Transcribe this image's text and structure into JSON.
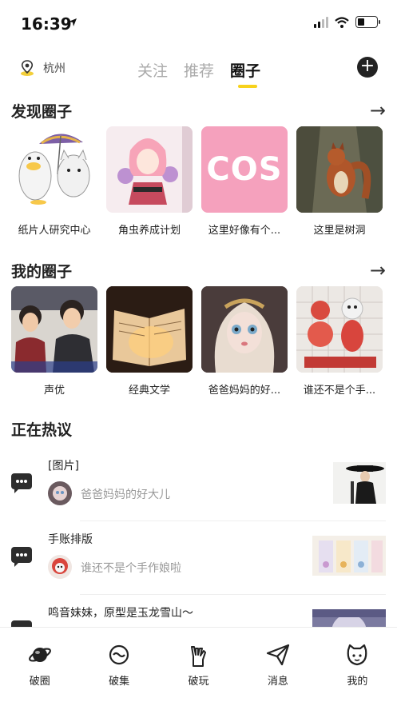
{
  "status": {
    "time": "16:39"
  },
  "header": {
    "location": "杭州",
    "tabs": [
      {
        "label": "关注"
      },
      {
        "label": "推荐"
      },
      {
        "label": "圈子"
      }
    ],
    "add": "+"
  },
  "discover": {
    "title": "发现圈子",
    "arrow": "→",
    "items": [
      {
        "label": "纸片人研究中心"
      },
      {
        "label": "角虫养成计划"
      },
      {
        "label": "这里好像有个..."
      },
      {
        "label": "这里是树洞"
      }
    ],
    "cos_text": "COS"
  },
  "mine": {
    "title": "我的圈子",
    "arrow": "→",
    "items": [
      {
        "label": "声优"
      },
      {
        "label": "经典文学"
      },
      {
        "label": "爸爸妈妈的好..."
      },
      {
        "label": "谁还不是个手..."
      }
    ]
  },
  "hot": {
    "title": "正在热议",
    "items": [
      {
        "title": "[图片]",
        "circle": "爸爸妈妈的好大儿"
      },
      {
        "title": "手账排版",
        "circle": "谁还不是个手作娘啦"
      },
      {
        "title": "鸣音妹妹，原型是玉龙雪山～",
        "circle": ""
      }
    ]
  },
  "bottom_nav": [
    {
      "label": "破圈",
      "icon": "planet-icon"
    },
    {
      "label": "破集",
      "icon": "ring-icon"
    },
    {
      "label": "破玩",
      "icon": "hand-icon"
    },
    {
      "label": "消息",
      "icon": "paper-plane-icon"
    },
    {
      "label": "我的",
      "icon": "cat-face-icon"
    }
  ]
}
